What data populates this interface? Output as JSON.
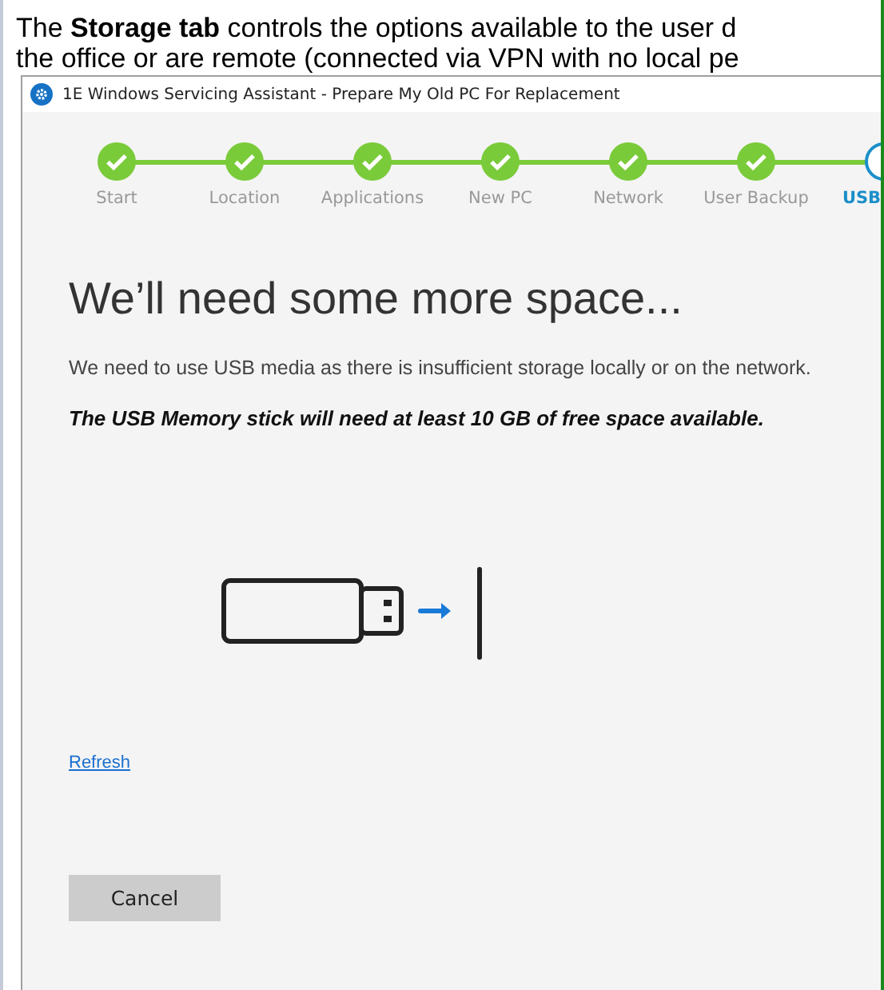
{
  "intro": [
    "The **Storage tab** controls the options available to the user d",
    "the office or are remote (connected via VPN with no local pe"
  ],
  "window": {
    "title": "1E Windows Servicing Assistant - Prepare My Old PC For Replacement"
  },
  "steps": [
    {
      "label": "Start",
      "completed": true,
      "selected": false
    },
    {
      "label": "Location",
      "completed": true,
      "selected": false
    },
    {
      "label": "Applications",
      "completed": true,
      "selected": false
    },
    {
      "label": "New PC",
      "completed": true,
      "selected": false
    },
    {
      "label": "Network",
      "completed": true,
      "selected": false
    },
    {
      "label": "User Backup",
      "completed": true,
      "selected": false
    },
    {
      "label": "USB",
      "completed": false,
      "selected": true
    }
  ],
  "heading": "We’ll need some more space...",
  "message": "We need to use USB media as there is insufficient storage locally or on the network.",
  "requirement": "The USB Memory stick will need at least 10 GB of free space available.",
  "refresh_link": "Refresh",
  "buttons": [
    "Cancel"
  ]
}
